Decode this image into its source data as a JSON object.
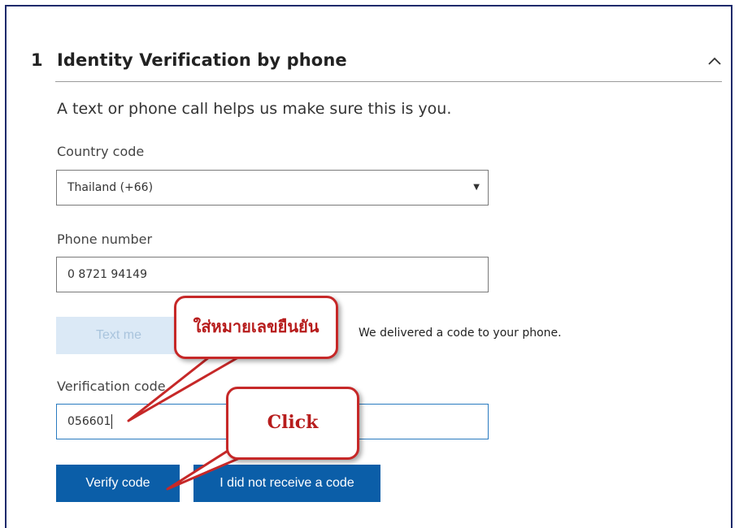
{
  "section": {
    "number": "1",
    "title": "Identity Verification by phone",
    "collapse_icon": "chevron-up-icon",
    "description": "A text or phone call helps us make sure this is you."
  },
  "country": {
    "label": "Country code",
    "selected": "Thailand (+66)",
    "arrow_icon": "dropdown-arrow-icon"
  },
  "phone": {
    "label": "Phone number",
    "value": "0 8721 94149"
  },
  "text_me_button": "Text me",
  "status_message": "We delivered a code to your phone.",
  "verification": {
    "label": "Verification code",
    "value": "056601"
  },
  "verify_button": "Verify code",
  "no_code_button": "I did not receive a code",
  "annotations": {
    "enter_code_callout": "ใส่หมายเลขยืนยัน",
    "click_callout": "Click",
    "callout_color": "#c62828"
  },
  "colors": {
    "primary_button": "#0b5ea8",
    "disabled_button": "#dbe9f6",
    "frame_border": "#1c2a6b"
  }
}
